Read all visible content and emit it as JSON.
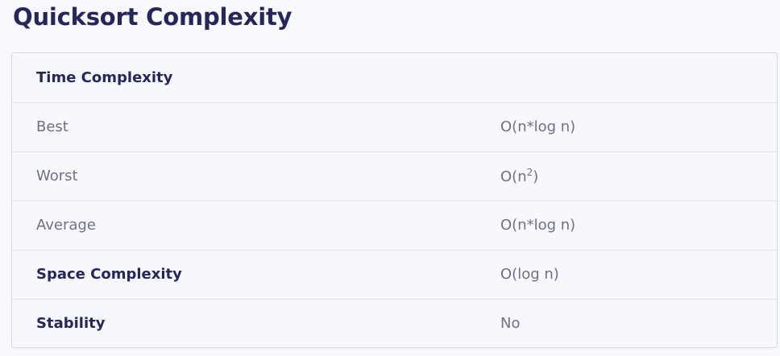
{
  "title": "Quicksort Complexity",
  "table": {
    "header": "Time Complexity",
    "rows": [
      {
        "label": "Best",
        "value": "O(n*log n)"
      },
      {
        "label": "Worst",
        "value_base": "O(n",
        "value_exp": "2",
        "value_close": ")"
      },
      {
        "label": "Average",
        "value": "O(n*log n)"
      },
      {
        "label": "Space Complexity",
        "value": "O(log n)"
      },
      {
        "label": "Stability",
        "value": "No"
      }
    ]
  }
}
